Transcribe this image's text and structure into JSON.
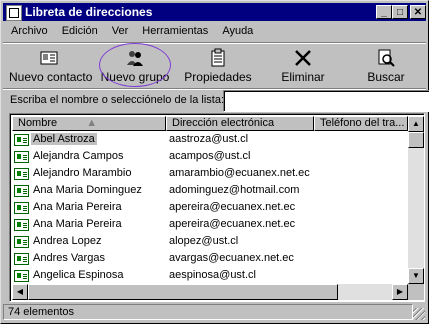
{
  "window": {
    "title": "Libreta de direcciones"
  },
  "menu": [
    "Archivo",
    "Edición",
    "Ver",
    "Herramientas",
    "Ayuda"
  ],
  "toolbar": {
    "new_contact": "Nuevo contacto",
    "new_group": "Nuevo grupo",
    "properties": "Propiedades",
    "delete": "Eliminar",
    "search": "Buscar"
  },
  "search": {
    "prompt": "Escriba el nombre o selecciónelo de la lista:",
    "value": ""
  },
  "columns": {
    "name": "Nombre",
    "email": "Dirección electrónica",
    "phone": "Teléfono del tra..."
  },
  "contacts": [
    {
      "name": "Abel Astroza",
      "email": "aastroza@ust.cl"
    },
    {
      "name": "Alejandra Campos",
      "email": "acampos@ust.cl"
    },
    {
      "name": "Alejandro Marambio",
      "email": "amarambio@ecuanex.net.ec"
    },
    {
      "name": "Ana Maria Dominguez",
      "email": "adominguez@hotmail.com"
    },
    {
      "name": "Ana Maria Pereira",
      "email": "apereira@ecuanex.net.ec"
    },
    {
      "name": "Ana Maria Pereira",
      "email": "apereira@ecuanex.net.ec"
    },
    {
      "name": "Andrea Lopez",
      "email": "alopez@ust.cl"
    },
    {
      "name": "Andres Vargas",
      "email": "avargas@ecuanex.net.ec"
    },
    {
      "name": "Angelica Espinosa",
      "email": "aespinosa@ust.cl"
    }
  ],
  "status": {
    "count": "74 elementos"
  }
}
